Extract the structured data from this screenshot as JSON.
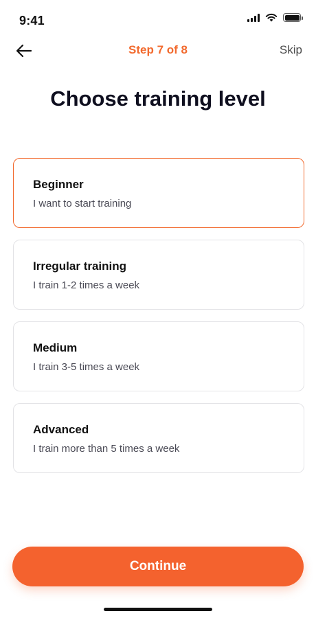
{
  "status_bar": {
    "time": "9:41"
  },
  "nav": {
    "step_label": "Step 7 of 8",
    "skip_label": "Skip"
  },
  "page": {
    "title": "Choose training level"
  },
  "options": [
    {
      "title": "Beginner",
      "description": "I want to start training",
      "selected": true
    },
    {
      "title": "Irregular training",
      "description": "I train 1-2 times a week",
      "selected": false
    },
    {
      "title": "Medium",
      "description": "I train 3-5 times a week",
      "selected": false
    },
    {
      "title": "Advanced",
      "description": "I train more than 5 times a week",
      "selected": false
    }
  ],
  "continue_label": "Continue",
  "icons": {
    "back": "arrow-left-icon",
    "signal": "cellular-signal-icon",
    "wifi": "wifi-icon",
    "battery": "battery-icon"
  },
  "colors": {
    "accent": "#F26A2E",
    "button": "#F4622E",
    "card_border": "#E3E3E6",
    "text": "#111111"
  }
}
